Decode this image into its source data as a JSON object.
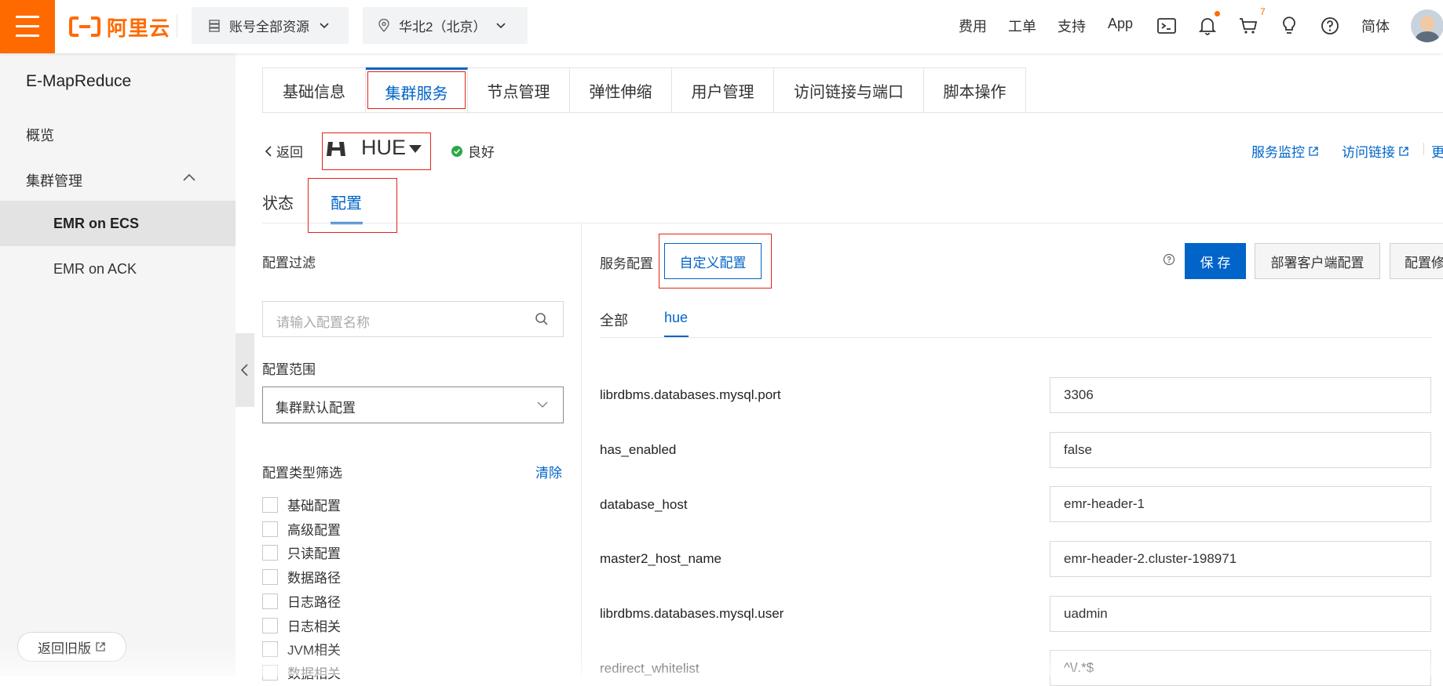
{
  "topbar": {
    "brand": "阿里云",
    "resource_selector": "账号全部资源",
    "region_selector": "华北2（北京）",
    "links": [
      "费用",
      "工单",
      "支持",
      "App"
    ],
    "cart_badge": "7",
    "language": "简体"
  },
  "sidebar": {
    "title": "E-MapReduce",
    "items": {
      "overview": "概览",
      "cluster_mgmt": "集群管理",
      "emr_ecs": "EMR on ECS",
      "emr_ack": "EMR on ACK"
    },
    "old_version": "返回旧版"
  },
  "tabs": [
    "基础信息",
    "集群服务",
    "节点管理",
    "弹性伸缩",
    "用户管理",
    "访问链接与端口",
    "脚本操作"
  ],
  "service": {
    "back": "返回",
    "name": "HUE",
    "status": "良好",
    "links": [
      "服务监控",
      "访问链接",
      "更"
    ]
  },
  "subtabs": {
    "status": "状态",
    "config": "配置"
  },
  "filter": {
    "title": "配置过滤",
    "search_placeholder": "请输入配置名称",
    "scope_label": "配置范围",
    "scope_value": "集群默认配置",
    "type_label": "配置类型筛选",
    "clear": "清除",
    "types": [
      "基础配置",
      "高级配置",
      "只读配置",
      "数据路径",
      "日志路径",
      "日志相关",
      "JVM相关",
      "数据相关"
    ]
  },
  "config": {
    "service_config_label": "服务配置",
    "custom_config": "自定义配置",
    "save": "保 存",
    "deploy_client": "部署客户端配置",
    "config_modify": "配置修",
    "tabs": {
      "all": "全部",
      "hue": "hue"
    },
    "rows": [
      {
        "key": "librdbms.databases.mysql.port",
        "value": "3306"
      },
      {
        "key": "has_enabled",
        "value": "false"
      },
      {
        "key": "database_host",
        "value": "emr-header-1"
      },
      {
        "key": "master2_host_name",
        "value": "emr-header-2.cluster-198971"
      },
      {
        "key": "librdbms.databases.mysql.user",
        "value": "uadmin"
      },
      {
        "key": "redirect_whitelist",
        "value": "^\\/.*$"
      }
    ]
  },
  "colors": {
    "brand": "#ff6a00",
    "primary": "#0064c8",
    "highlight": "#e2231a",
    "success": "#2aa845"
  }
}
